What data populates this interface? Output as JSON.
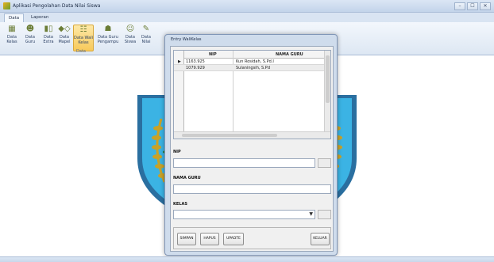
{
  "window": {
    "title": "Aplikasi Pengolahan Data Nilai Siswa",
    "minimize_glyph": "–",
    "maximize_glyph": "☐",
    "close_glyph": "✕"
  },
  "ribbon": {
    "tabs": [
      {
        "label": "Data",
        "active": true
      },
      {
        "label": "Laporan",
        "active": false
      }
    ],
    "buttons": [
      {
        "line1": "Data",
        "line2": "Kelas",
        "icon": "class-icon"
      },
      {
        "line1": "Data",
        "line2": "Guru",
        "icon": "teacher-icon"
      },
      {
        "line1": "Data",
        "line2": "Extra",
        "icon": "extra-icon"
      },
      {
        "line1": "Data",
        "line2": "Mapel",
        "icon": "subject-icon"
      },
      {
        "line1": "Data Wali",
        "line2": "Kelas",
        "icon": "homeroom-icon",
        "active": true
      },
      {
        "line1": "Data Guru",
        "line2": "Pengampu",
        "icon": "assigned-teacher-icon"
      },
      {
        "line1": "Data",
        "line2": "Siswa",
        "icon": "students-icon"
      },
      {
        "line1": "Data",
        "line2": "Nilai",
        "icon": "grades-icon"
      }
    ],
    "group_label": "Data"
  },
  "dialog": {
    "title": "Entry WaliKelas",
    "grid": {
      "columns": [
        "NIP",
        "NAMA GURU"
      ],
      "rows": [
        {
          "nip": "1163.925",
          "nama": "Kun Rosidah, S.Pd.I",
          "current": true
        },
        {
          "nip": "1079.929",
          "nama": "Sulaningsih, S.Pd",
          "current": false
        }
      ]
    },
    "fields": {
      "nip_label": "NIP",
      "nama_label": "NAMA GURU",
      "kelas_label": "KELAS"
    },
    "buttons": {
      "simpan": "SIMPAN",
      "hapus": "HAPUS",
      "update": "UPADTE",
      "keluar": "KELUAR"
    }
  },
  "colors": {
    "accent": "#f7c95a",
    "emblem_blue": "#3bb3e4",
    "emblem_gold": "#c9a227",
    "dialog_frame": "#cfdcec"
  }
}
